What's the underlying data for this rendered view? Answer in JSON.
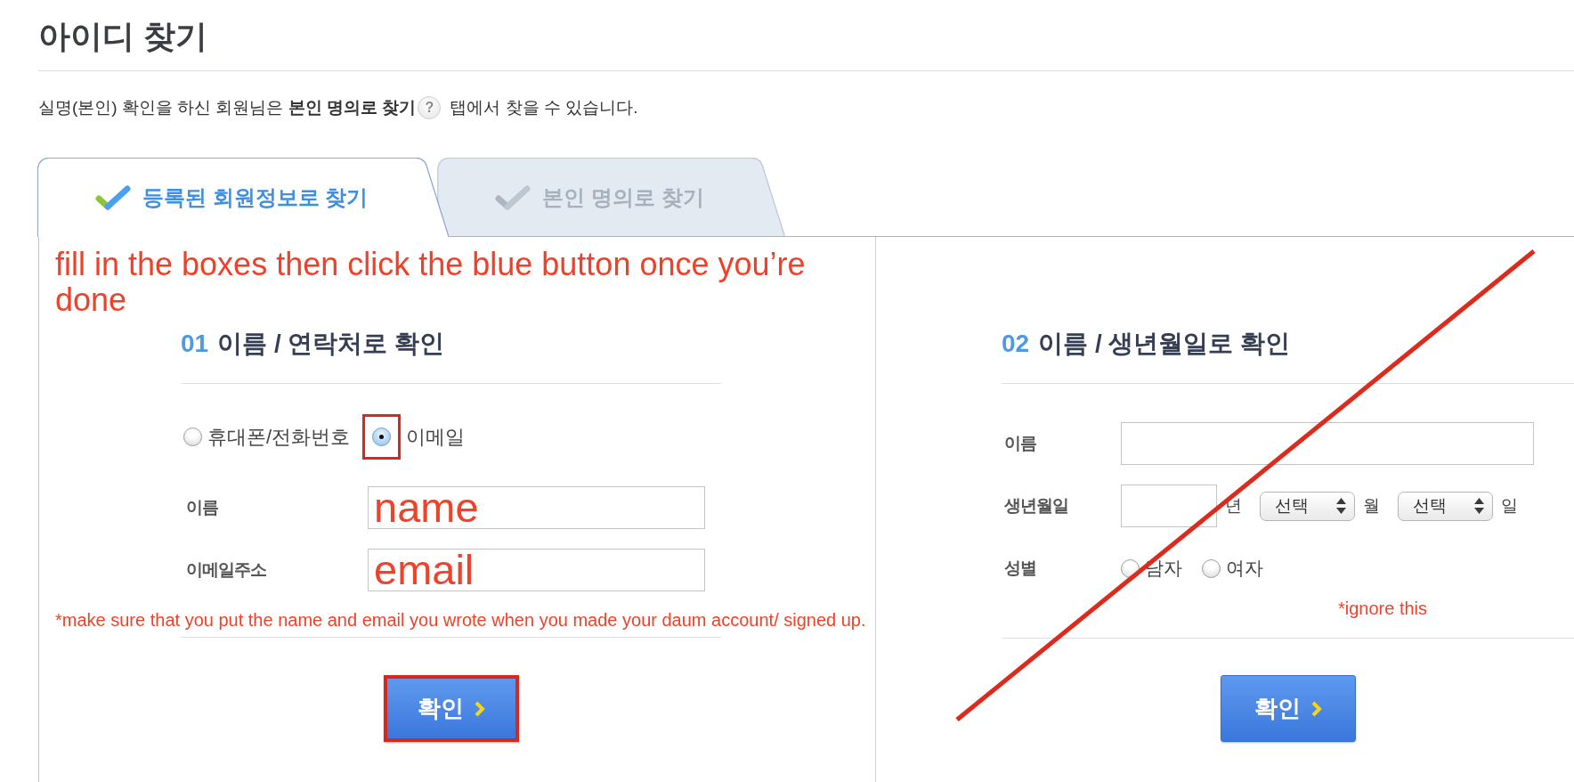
{
  "page_title": "아이디 찾기",
  "notice": {
    "lead": "실명(본인) 확인을 하신 회원님은 **본인 명의로 찾기**",
    "help_icon": "?",
    "tail": "탭에서 찾을 수 있습니다."
  },
  "tabs": [
    {
      "label": "등록된 회원정보로 찾기",
      "selected": true
    },
    {
      "label": "본인 명의로 찾기",
      "selected": false
    }
  ],
  "sections": [
    {
      "annotation": "fill in the boxes then click the blue button once you’re done",
      "number": "01",
      "heading": "이름 / 연락처로 확인",
      "rows": [
        {
          "kind": "choice",
          "options": [
            {
              "label": "휴대폰/전화번호",
              "selected": false
            },
            {
              "label": "이메일",
              "selected": true,
              "highlighted": true
            }
          ]
        },
        {
          "kind": "text",
          "label": "이름",
          "value": "name"
        },
        {
          "kind": "text",
          "label": "이메일주소",
          "value": "email"
        }
      ],
      "note": "*make sure that you put the name and email you wrote when you made your daum account/ signed up.",
      "button": {
        "label": "확인",
        "highlighted": true
      }
    },
    {
      "number": "02",
      "heading": "이름 / 생년월일로 확인",
      "crossed_out": true,
      "rows": [
        {
          "kind": "text",
          "label": "이름"
        },
        {
          "kind": "date",
          "label": "생년월일",
          "parts": [
            {
              "kind": "input"
            },
            {
              "kind": "unit",
              "text": "년"
            },
            {
              "kind": "select",
              "value": "선택"
            },
            {
              "kind": "unit",
              "text": "월"
            },
            {
              "kind": "select",
              "value": "선택"
            },
            {
              "kind": "unit",
              "text": "일"
            }
          ]
        },
        {
          "kind": "radio",
          "label": "성별",
          "options": [
            {
              "label": "남자",
              "selected": false
            },
            {
              "label": "여자",
              "selected": false
            }
          ]
        }
      ],
      "note": "*ignore this",
      "button": {
        "label": "확인",
        "highlighted": false
      }
    }
  ]
}
